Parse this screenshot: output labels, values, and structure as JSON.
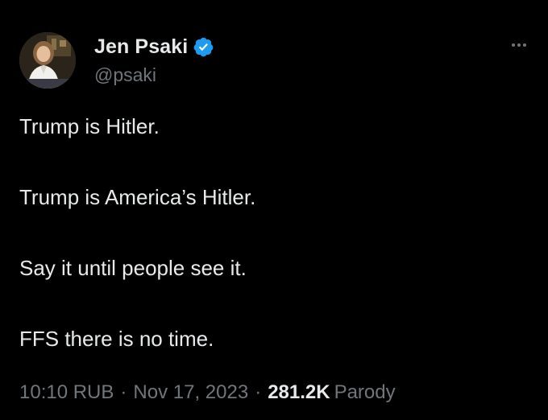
{
  "author": {
    "display_name": "Jen Psaki",
    "handle": "@psaki",
    "verified": true
  },
  "tweet": {
    "lines": [
      "Trump is Hitler.",
      "Trump is America’s Hitler.",
      "Say it until people see it.",
      "FFS there is no time."
    ]
  },
  "meta": {
    "time": "10:10 RUB",
    "date": "Nov 17, 2023",
    "separator": "·",
    "views_count": "281.2K",
    "views_label": "Parody"
  },
  "icons": {
    "verified": "verified-badge-icon",
    "more": "more-options-icon"
  },
  "colors": {
    "background": "#000000",
    "primary_text": "#e7e9ea",
    "secondary_text": "#71767b",
    "verified_blue": "#1d9bf0"
  }
}
